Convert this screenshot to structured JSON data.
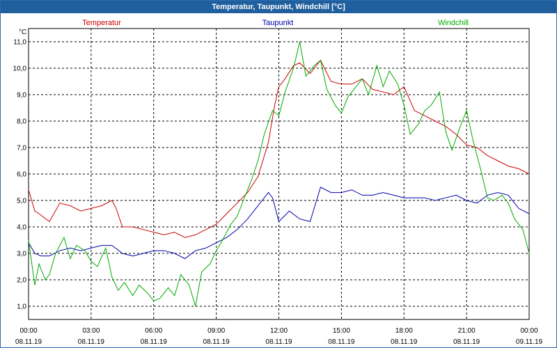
{
  "window": {
    "title": "Temperatur, Taupunkt, Windchill [°C]"
  },
  "chart_data": {
    "type": "line",
    "title": "Temperatur, Taupunkt, Windchill [°C]",
    "ylabel": "°C",
    "ylim": [
      0.5,
      11.5
    ],
    "xlim": [
      0,
      24
    ],
    "grid": true,
    "legend_placement": "top",
    "y_ticks": [
      "1,0",
      "2,0",
      "3,0",
      "4,0",
      "5,0",
      "6,0",
      "7,0",
      "8,0",
      "9,0",
      "10,0",
      "11,0"
    ],
    "x_ticks": [
      {
        "time": "00:00",
        "date": "08.11.19"
      },
      {
        "time": "03:00",
        "date": "08.11.19"
      },
      {
        "time": "06:00",
        "date": "08.11.19"
      },
      {
        "time": "09:00",
        "date": "08.11.19"
      },
      {
        "time": "12:00",
        "date": "08.11.19"
      },
      {
        "time": "15:00",
        "date": "08.11.19"
      },
      {
        "time": "18:00",
        "date": "08.11.19"
      },
      {
        "time": "21:00",
        "date": "08.11.19"
      },
      {
        "time": "00:00",
        "date": "09.11.19"
      }
    ],
    "series": [
      {
        "name": "Temperatur",
        "color": "#cc0000",
        "x": [
          0,
          0.3,
          0.5,
          1,
          1.5,
          2,
          2.5,
          3,
          3.5,
          4,
          4.2,
          4.5,
          5,
          5.5,
          6,
          6.5,
          7,
          7.5,
          8,
          8.5,
          9,
          9.5,
          10,
          10.5,
          11,
          11.5,
          11.8,
          12,
          12.3,
          12.7,
          13,
          13.5,
          14,
          14.5,
          15,
          15.5,
          16,
          16.5,
          17,
          17.5,
          18,
          18.5,
          19,
          19.5,
          20,
          20.5,
          21,
          21.5,
          22,
          22.5,
          23,
          23.5,
          24
        ],
        "values": [
          5.4,
          4.6,
          4.5,
          4.2,
          4.9,
          4.8,
          4.6,
          4.7,
          4.8,
          5.0,
          4.7,
          4.0,
          4.0,
          3.9,
          3.8,
          3.7,
          3.8,
          3.6,
          3.7,
          3.9,
          4.1,
          4.5,
          4.9,
          5.3,
          5.9,
          7.2,
          8.6,
          9.3,
          9.6,
          10.1,
          10.2,
          9.8,
          10.3,
          9.5,
          9.4,
          9.4,
          9.6,
          9.2,
          9.1,
          9.0,
          9.3,
          8.4,
          8.2,
          8.0,
          7.8,
          7.5,
          7.1,
          7.0,
          6.7,
          6.5,
          6.3,
          6.2,
          6.0
        ]
      },
      {
        "name": "Taupunkt",
        "color": "#0000aa",
        "x": [
          0,
          0.3,
          0.6,
          1,
          1.5,
          2,
          2.5,
          3,
          3.5,
          4,
          4.5,
          5,
          5.5,
          6,
          6.5,
          7,
          7.5,
          8,
          8.5,
          9,
          9.5,
          10,
          10.5,
          11,
          11.5,
          11.7,
          12,
          12.5,
          13,
          13.5,
          14,
          14.5,
          15,
          15.5,
          16,
          16.5,
          17,
          17.5,
          18,
          18.5,
          19,
          19.5,
          20,
          20.5,
          21,
          21.5,
          22,
          22.5,
          23,
          23.5,
          24
        ],
        "values": [
          3.4,
          3.0,
          2.9,
          2.9,
          3.1,
          3.2,
          3.1,
          3.2,
          3.3,
          3.3,
          3.0,
          2.9,
          3.0,
          3.1,
          3.1,
          3.0,
          2.8,
          3.1,
          3.2,
          3.4,
          3.6,
          3.9,
          4.3,
          4.8,
          5.3,
          5.1,
          4.2,
          4.6,
          4.3,
          4.2,
          5.5,
          5.3,
          5.3,
          5.4,
          5.2,
          5.2,
          5.3,
          5.2,
          5.1,
          5.1,
          5.1,
          5.0,
          5.1,
          5.2,
          5.0,
          4.9,
          5.2,
          5.3,
          5.2,
          4.7,
          4.5
        ]
      },
      {
        "name": "Windchill",
        "color": "#00aa00",
        "x": [
          0,
          0.3,
          0.5,
          0.8,
          1,
          1.3,
          1.7,
          2,
          2.3,
          2.7,
          3,
          3.3,
          3.7,
          4,
          4.3,
          4.6,
          5,
          5.3,
          5.7,
          6,
          6.3,
          6.7,
          7,
          7.3,
          7.7,
          8,
          8.3,
          8.7,
          9,
          9.3,
          9.7,
          10,
          10.3,
          10.7,
          11,
          11.3,
          11.7,
          12,
          12.3,
          12.7,
          13,
          13.3,
          13.7,
          14,
          14.3,
          14.7,
          15,
          15.3,
          15.7,
          16,
          16.3,
          16.7,
          17,
          17.3,
          17.7,
          18,
          18.3,
          18.7,
          19,
          19.3,
          19.7,
          20,
          20.3,
          20.7,
          21,
          21.3,
          21.7,
          22,
          22.3,
          22.7,
          23,
          23.3,
          23.7,
          24
        ],
        "values": [
          3.5,
          1.8,
          2.6,
          2.0,
          2.2,
          3.0,
          3.6,
          2.8,
          3.3,
          3.1,
          2.7,
          2.5,
          3.2,
          2.1,
          1.6,
          1.9,
          1.4,
          1.8,
          1.5,
          1.2,
          1.3,
          1.7,
          1.4,
          2.2,
          1.8,
          1.0,
          2.3,
          2.6,
          3.1,
          3.5,
          4.1,
          4.4,
          5.0,
          5.8,
          6.5,
          7.5,
          8.4,
          8.2,
          9.1,
          10.0,
          11.0,
          9.7,
          10.1,
          10.3,
          9.2,
          8.6,
          8.3,
          8.9,
          9.3,
          9.6,
          9.0,
          10.1,
          9.3,
          9.9,
          9.4,
          8.6,
          7.5,
          7.9,
          8.4,
          8.6,
          9.1,
          7.6,
          6.9,
          7.8,
          8.4,
          7.3,
          6.1,
          5.1,
          5.0,
          5.2,
          4.9,
          4.3,
          3.9,
          3.0
        ]
      }
    ]
  }
}
